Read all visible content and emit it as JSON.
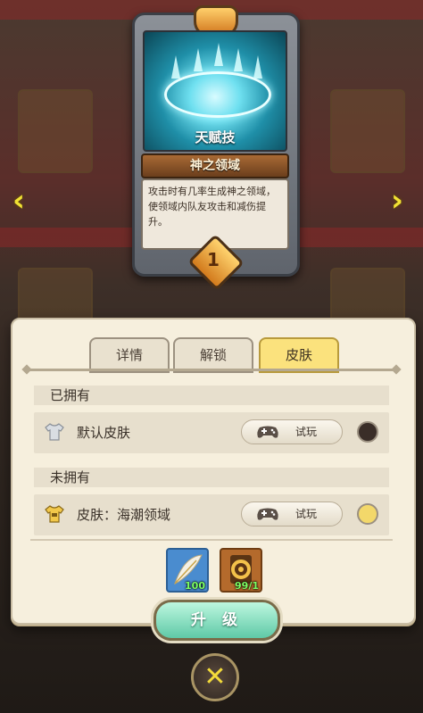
{
  "skill_card": {
    "art_label": "天赋技",
    "name": "神之领域",
    "description": "攻击时有几率生成神之领域，使领域内队友攻击和减伤提升。",
    "level": "1"
  },
  "navigation": {
    "prev_arrow": "‹",
    "next_arrow": "›"
  },
  "tabs": [
    {
      "label": "详情",
      "active": false
    },
    {
      "label": "解锁",
      "active": false
    },
    {
      "label": "皮肤",
      "active": true
    }
  ],
  "owned_section": {
    "title": "已拥有",
    "items": [
      {
        "icon": "shirt-icon",
        "label": "默认皮肤",
        "trial_label": "试玩",
        "selected": true
      }
    ]
  },
  "unowned_section": {
    "title": "未拥有",
    "items": [
      {
        "icon": "golden-shirt-icon",
        "label": "皮肤：海潮领域",
        "trial_label": "试玩",
        "selected": false
      }
    ]
  },
  "materials": [
    {
      "icon": "feather-icon",
      "count": "100",
      "bg": "#4a8ccf"
    },
    {
      "icon": "gold-ring-icon",
      "count": "99/1",
      "bg": "#b46a2c"
    }
  ],
  "upgrade_label": "升 级",
  "close_label": "✕",
  "colors": {
    "active_tab": "#fbe27d",
    "count_text": "#7cff63",
    "radio_selected": "#3a2e28",
    "radio_unselected": "#f3d86a"
  }
}
